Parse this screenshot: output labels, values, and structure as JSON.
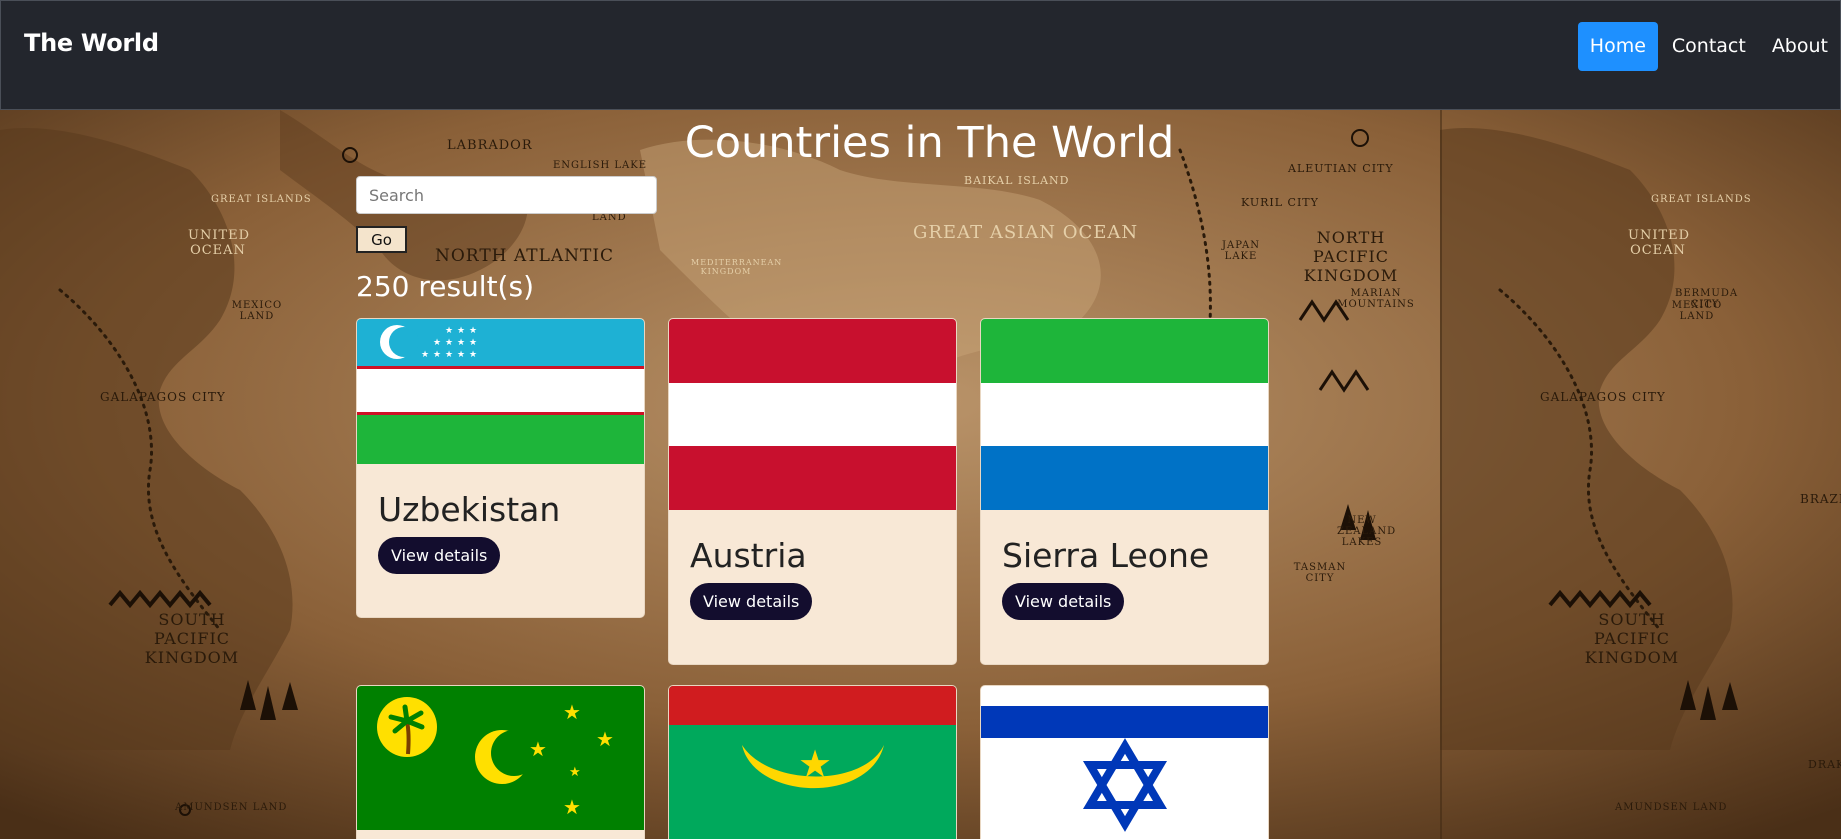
{
  "navbar": {
    "brand": "The World",
    "links": [
      {
        "label": "Home",
        "active": true
      },
      {
        "label": "Contact",
        "active": false
      },
      {
        "label": "About",
        "active": false
      }
    ]
  },
  "page": {
    "title": "Countries in The World",
    "search": {
      "placeholder": "Search",
      "value": ""
    },
    "go_label": "Go",
    "results_label": "250 result(s)"
  },
  "map_labels": {
    "labrador": "LABRADOR",
    "english_lake": "ENGLISH LAKE",
    "north_atlantic": "NORTH ATLANTIC",
    "baikal": "BAIKAL ISLAND",
    "aleutian": "ALEUTIAN CITY",
    "kuril": "KURIL CITY",
    "great_asian_ocean": "GREAT ASIAN OCEAN",
    "north_pacific": "NORTH PACIFIC KINGDOM",
    "great_islands": "GREAT ISLANDS",
    "united_ocean": "UNITED OCEAN",
    "mexico_land": "MEXICO LAND",
    "bermuda_city": "BERMUDA CITY",
    "galapagos": "GALAPAGOS CITY",
    "south_pacific": "SOUTH PACIFIC KINGDOM",
    "amundsen": "AMUNDSEN LAND",
    "mediterranean": "MEDITERRANEAN KINGDOM",
    "marian": "MARIAN MOUNTAINS",
    "new_zealand": "NEW ZEALAND LAKES",
    "tasman": "TASMAN CITY",
    "japan_lake": "JAPAN LAKE",
    "land": "LAND",
    "brazil": "BRAZIL",
    "drake": "DRAK"
  },
  "countries": [
    {
      "name": "Uzbekistan",
      "button": "View details",
      "flag": "uzbekistan"
    },
    {
      "name": "Austria",
      "button": "View details",
      "flag": "austria"
    },
    {
      "name": "Sierra Leone",
      "button": "View details",
      "flag": "sierra-leone"
    },
    {
      "name": "",
      "button": "View details",
      "flag": "cocos-keeling-islands"
    },
    {
      "name": "",
      "button": "View details",
      "flag": "mauritania"
    },
    {
      "name": "",
      "button": "View details",
      "flag": "israel"
    }
  ],
  "colors": {
    "navbar_bg": "#23262d",
    "active_link": "#1e90ff",
    "card_bg": "#f8e8d6",
    "button_bg": "#130d2e"
  }
}
